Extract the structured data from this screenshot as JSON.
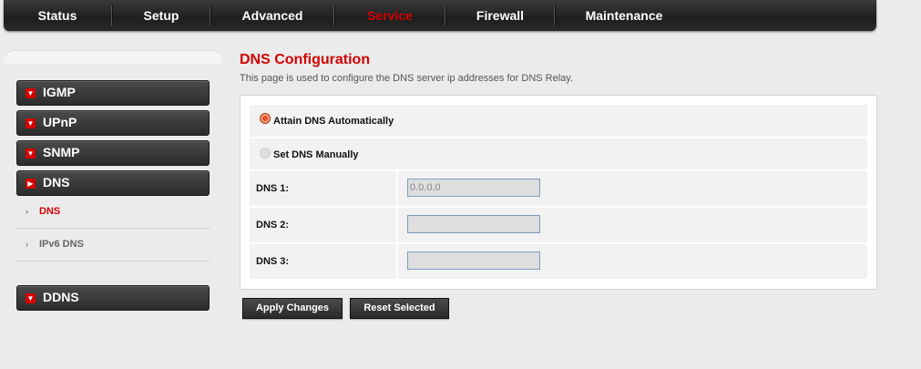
{
  "nav": {
    "tabs": [
      {
        "label": "Status"
      },
      {
        "label": "Setup"
      },
      {
        "label": "Advanced"
      },
      {
        "label": "Service"
      },
      {
        "label": "Firewall"
      },
      {
        "label": "Maintenance"
      }
    ],
    "active_tab": "Service"
  },
  "sidebar": {
    "menus": [
      {
        "label": "IGMP",
        "icon": "chevron-down-icon"
      },
      {
        "label": "UPnP",
        "icon": "chevron-down-icon"
      },
      {
        "label": "SNMP",
        "icon": "chevron-down-icon"
      },
      {
        "label": "DNS",
        "icon": "chevron-right-icon"
      },
      {
        "label": "DDNS",
        "icon": "chevron-down-icon"
      }
    ],
    "dns_sub_items": [
      {
        "label": "DNS",
        "active": true
      },
      {
        "label": "IPv6 DNS",
        "active": false
      }
    ]
  },
  "main": {
    "title": "DNS Configuration",
    "description": "This page is used to configure the DNS server ip addresses for DNS Relay.",
    "mode_options": [
      {
        "label": "Attain DNS Automatically",
        "selected": true
      },
      {
        "label": "Set DNS Manually",
        "selected": false
      }
    ],
    "fields": [
      {
        "label": "DNS 1:",
        "value": "0.0.0.0"
      },
      {
        "label": "DNS 2:",
        "value": ""
      },
      {
        "label": "DNS 3:",
        "value": ""
      }
    ],
    "buttons": {
      "apply": "Apply Changes",
      "reset": "Reset Selected"
    }
  },
  "colors": {
    "accent": "#d40000",
    "nav_bg": "#2a2a2a",
    "radio_on": "#e0532c"
  }
}
